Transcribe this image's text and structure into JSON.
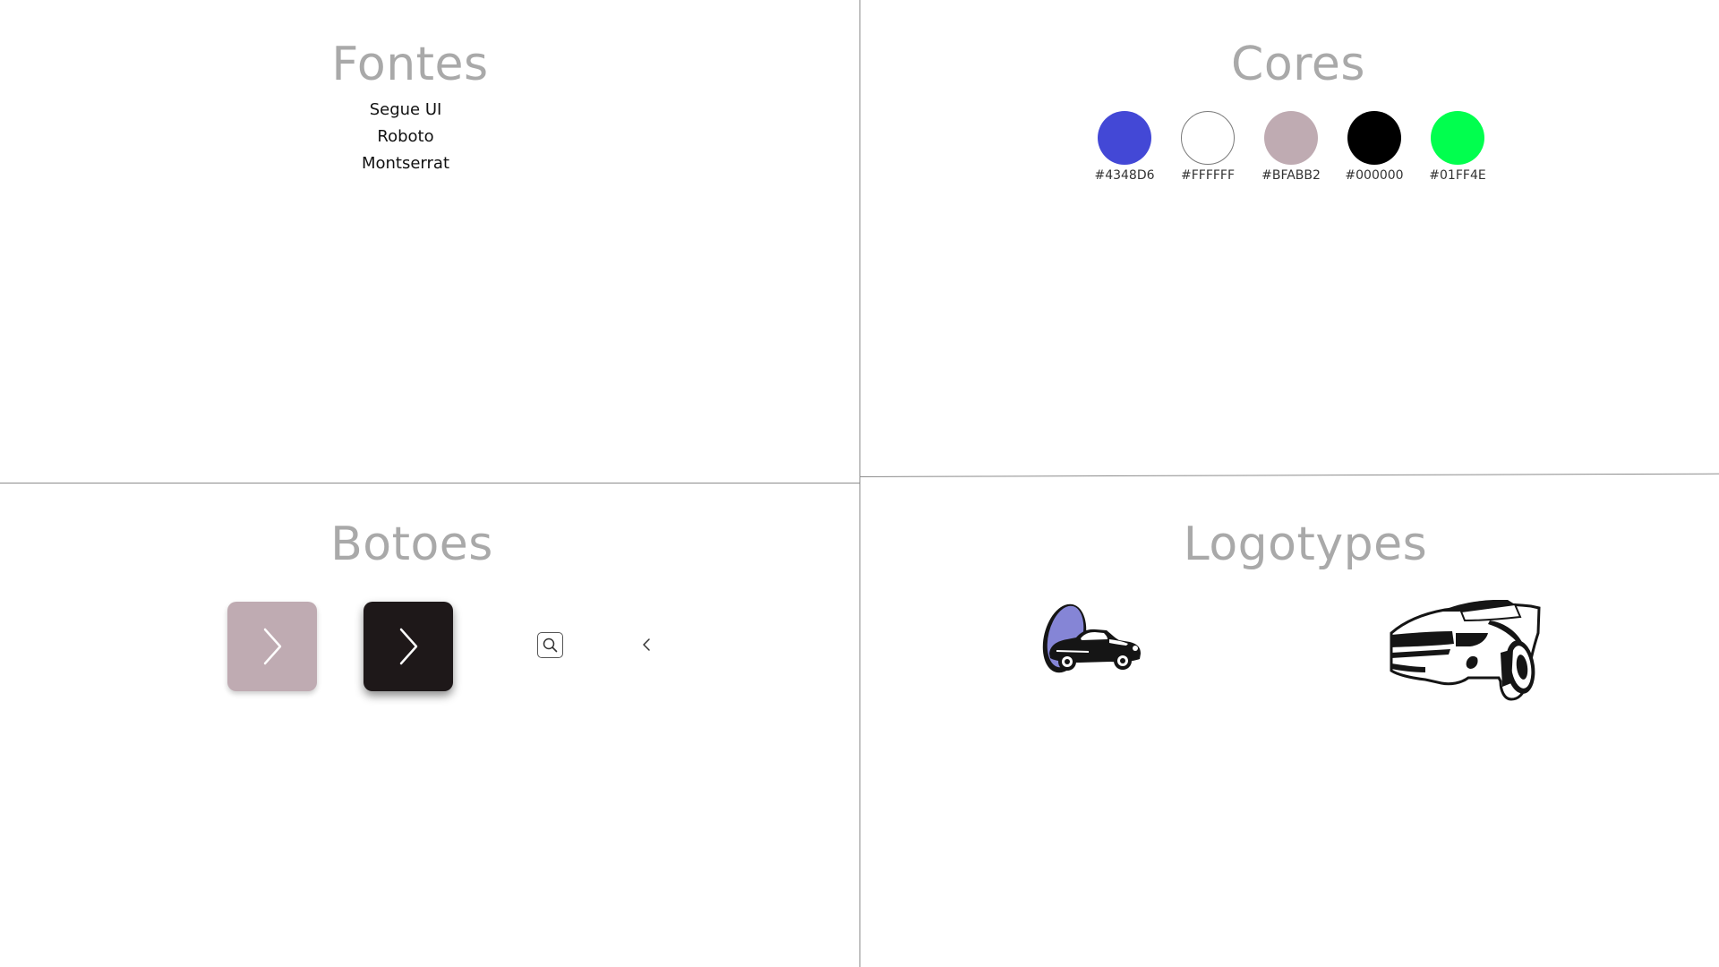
{
  "fonts": {
    "title": "Fontes",
    "items": [
      "Segue UI",
      "Roboto",
      "Montserrat"
    ]
  },
  "colors": {
    "title": "Cores",
    "swatches": [
      {
        "hex": "#4348D6",
        "label": "#4348D6"
      },
      {
        "hex": "#FFFFFF",
        "label": "#FFFFFF"
      },
      {
        "hex": "#BFABB2",
        "label": "#BFABB2"
      },
      {
        "hex": "#000000",
        "label": "#000000"
      },
      {
        "hex": "#01FF4E",
        "label": "#01FF4E"
      }
    ]
  },
  "buttons": {
    "title": "Botoes",
    "items": [
      {
        "kind": "next-button-light",
        "icon": "chevron-right-icon",
        "background": "#BFABB2",
        "icon_color": "#FFFFFF"
      },
      {
        "kind": "next-button-dark",
        "icon": "chevron-right-icon",
        "background": "#1E1819",
        "icon_color": "#FFFFFF"
      },
      {
        "kind": "search-button",
        "icon": "search-icon"
      },
      {
        "kind": "back-button",
        "icon": "chevron-left-icon"
      }
    ]
  },
  "logos": {
    "title": "Logotypes",
    "items": [
      {
        "name": "oval-car-logo",
        "accent": "#8585D6"
      },
      {
        "name": "sports-car-logo"
      }
    ]
  },
  "theme": {
    "heading_color": "#A9A9A9",
    "divider_color": "#8C8C8C"
  }
}
